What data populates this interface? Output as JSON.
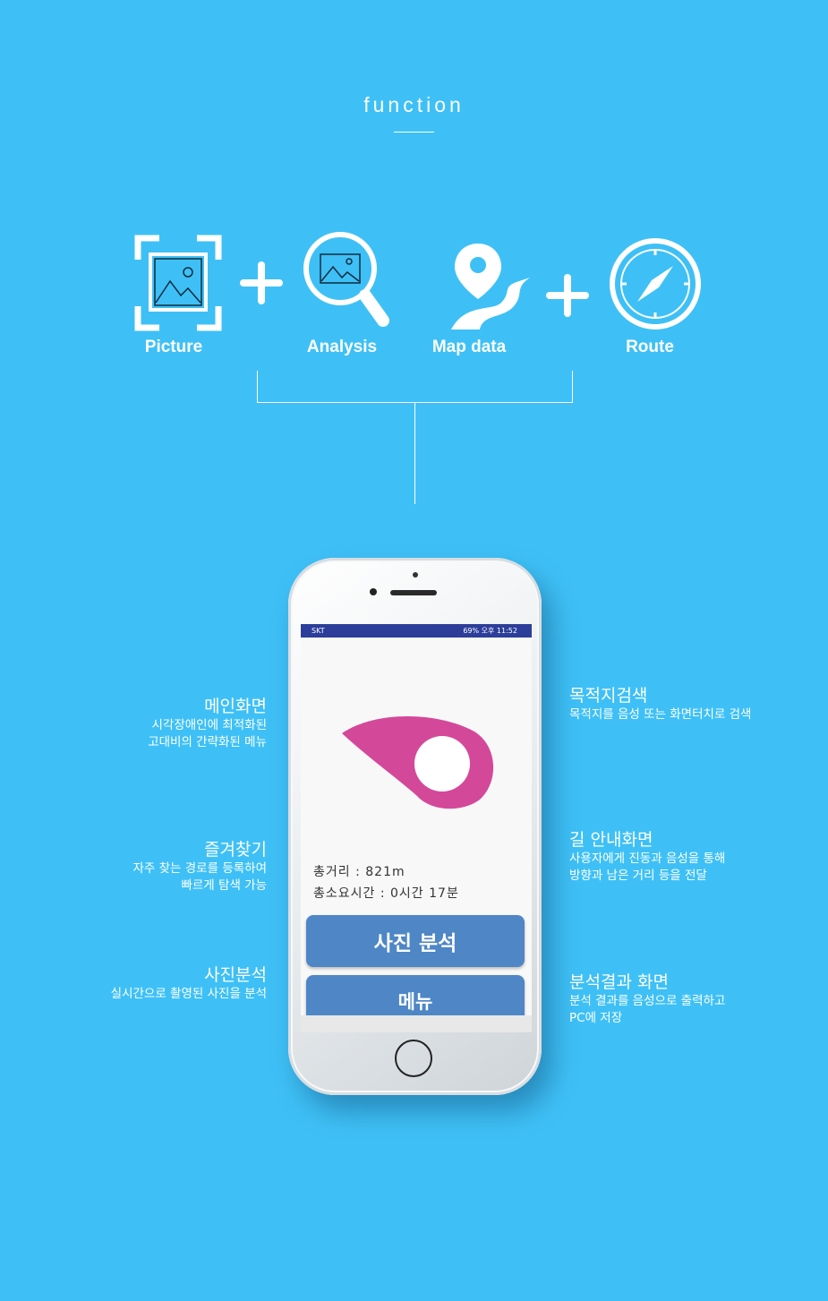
{
  "header": {
    "title": "function"
  },
  "functions": [
    {
      "label": "Picture",
      "icon": "picture-frame-icon"
    },
    {
      "label": "Analysis",
      "icon": "magnifier-image-icon"
    },
    {
      "label": "Map data",
      "icon": "map-pin-road-icon"
    },
    {
      "label": "Route",
      "icon": "compass-icon"
    }
  ],
  "phone": {
    "statusbar": {
      "left": "SKT",
      "right": "69% 오후 11:52"
    },
    "distance": "총거리 : 821m",
    "duration": "총소요시간 : 0시간 17분",
    "analyze_button": "사진 분석",
    "menu_button": "메뉴",
    "pin_color": "#d4489a"
  },
  "annotations_left": [
    {
      "title": "메인화면",
      "desc": [
        "시각장애인에 최적화된",
        "고대비의 간략화된 메뉴"
      ]
    },
    {
      "title": "즐겨찾기",
      "desc": [
        "자주 찾는 경로를 등록하여",
        "빠르게 탐색 가능"
      ]
    },
    {
      "title": "사진분석",
      "desc": [
        "실시간으로 촬영된 사진을 분석"
      ]
    }
  ],
  "annotations_right": [
    {
      "title": "목적지검색",
      "desc": [
        "목적지를 음성 또는 화면터치로 검색"
      ]
    },
    {
      "title": "길 안내화면",
      "desc": [
        "사용자에게 진동과 음성을 통해",
        "방향과 남은 거리 등을 전달"
      ]
    },
    {
      "title": "분석결과 화면",
      "desc": [
        "분석 결과를 음성으로 출력하고",
        "PC에 저장"
      ]
    }
  ],
  "colors": {
    "background": "#3ec0f6",
    "button": "#4e86c6",
    "statusbar": "#2c3e9a"
  }
}
